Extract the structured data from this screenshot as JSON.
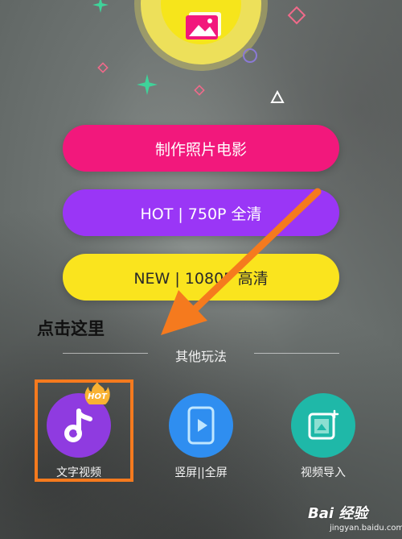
{
  "buttons": {
    "make_movie": "制作照片电影",
    "hot_750p": "HOT | 750P 全清",
    "new_1080p": "NEW | 1080P 高清"
  },
  "annotation": "点击这里",
  "section": {
    "title": "其他玩法"
  },
  "features": [
    {
      "label": "文字视频",
      "badge": "HOT",
      "icon": "music-note-icon"
    },
    {
      "label": "竖屏||全屏",
      "icon": "phone-play-icon"
    },
    {
      "label": "视频导入",
      "icon": "film-import-icon"
    }
  ],
  "watermark": {
    "brand": "Bai 经验",
    "url": "jingyan.baidu.com"
  },
  "colors": {
    "pink": "#f2187c",
    "purple": "#9a36f6",
    "yellow": "#fae41e",
    "arrow_orange": "#f57a1e",
    "feature_purple": "#8f3be0",
    "feature_blue": "#2f8ef0",
    "feature_teal": "#1fb8a8"
  }
}
